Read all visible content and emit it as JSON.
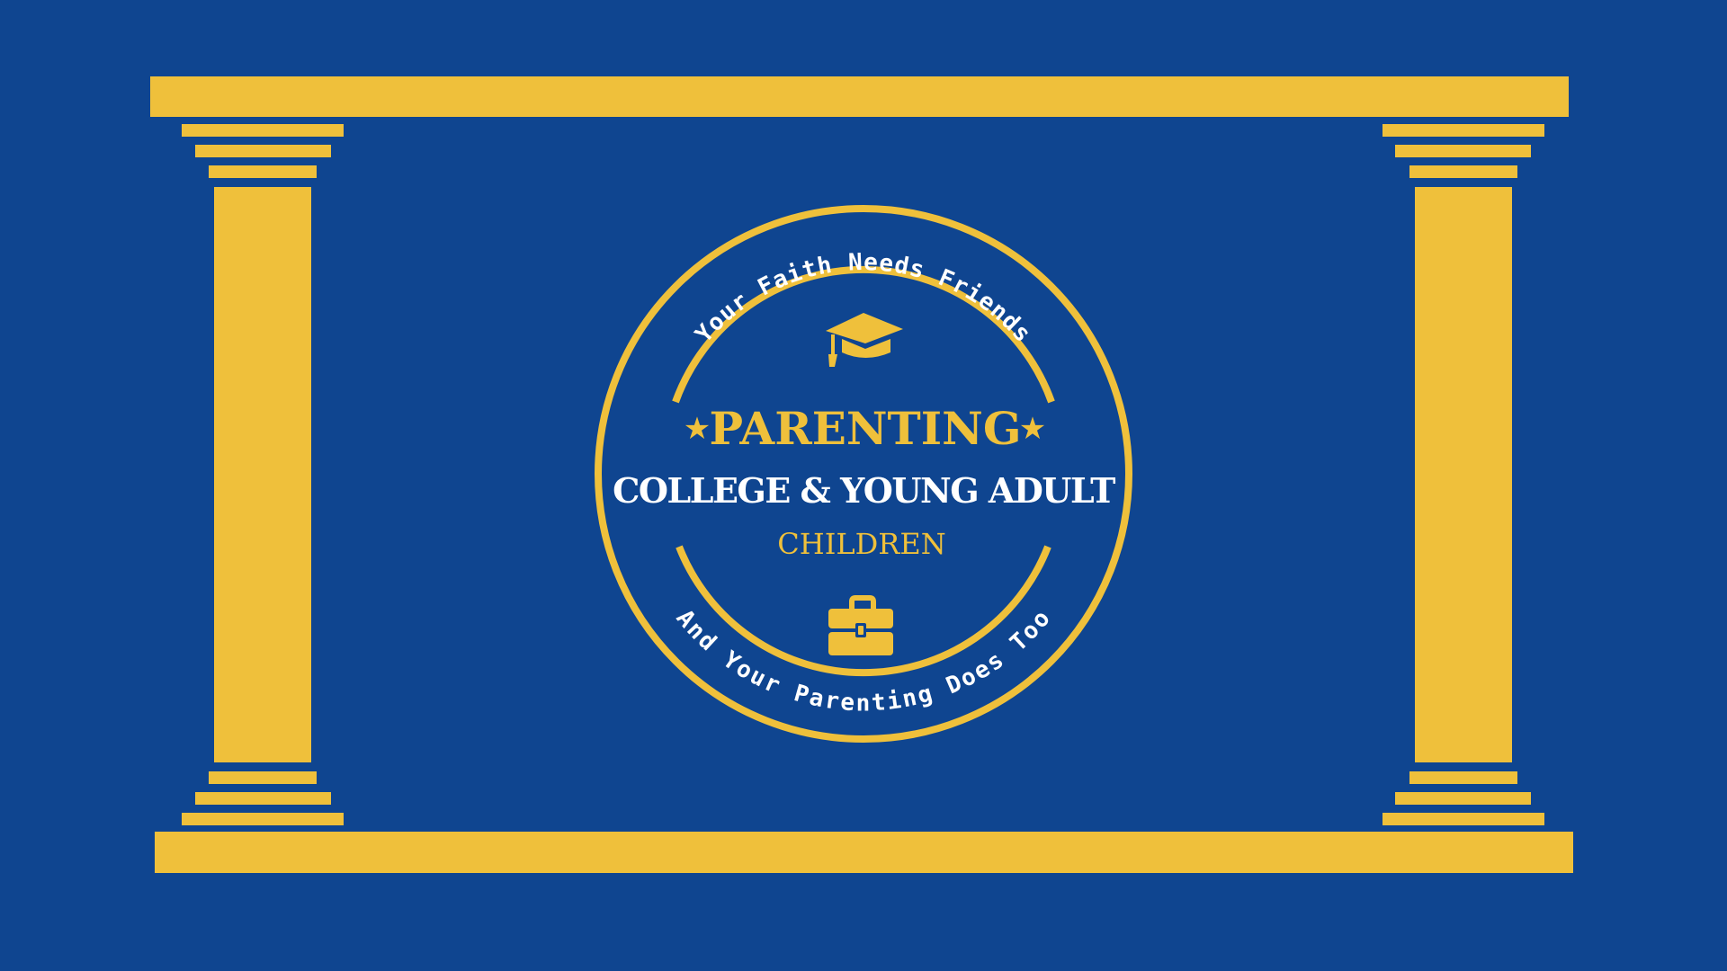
{
  "colors": {
    "background": "#0f4590",
    "gold": "#efc03b",
    "white": "#ffffff"
  },
  "badge": {
    "arc_top_text": "Your Faith Needs Friends",
    "arc_bottom_text": "And Your Parenting Does Too",
    "title": "PARENTING",
    "subtitle": "COLLEGE & YOUNG ADULT",
    "tagline": "CHILDREN",
    "star_left": "★",
    "star_right": "★",
    "top_icon": "graduation-cap-icon",
    "bottom_icon": "briefcase-icon"
  },
  "scene": {
    "decoration": "two-gold-pillars"
  }
}
